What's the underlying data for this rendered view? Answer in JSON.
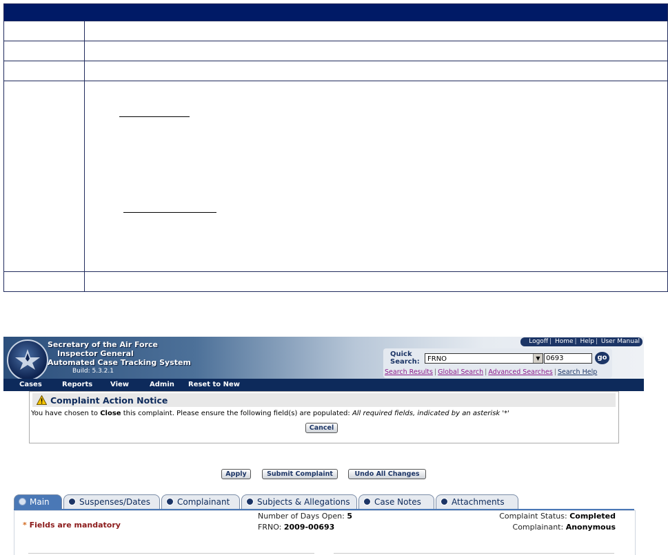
{
  "header": {
    "title_line1": "Secretary of the Air Force",
    "title_line2": "Inspector General",
    "title_line3": "Automated Case Tracking System",
    "build": "Build: 5.3.2.1"
  },
  "top_links": [
    "Logoff",
    "Home",
    "Help",
    "User Manual"
  ],
  "quick_search": {
    "label_line1": "Quick",
    "label_line2": "Search:",
    "field_selected": "FRNO",
    "value": "0693",
    "go_label": "go",
    "links": [
      "Search Results",
      "Global Search",
      "Advanced Searches",
      "Search Help"
    ]
  },
  "menu": [
    "Cases",
    "Reports",
    "View",
    "Admin",
    "Reset to New"
  ],
  "notice": {
    "title": "Complaint Action Notice",
    "text_prefix": "You have chosen to ",
    "text_action": "Close",
    "text_middle": " this complaint. Please ensure the following field(s) are populated: ",
    "text_fields": "All required fields, indicated by an asterisk '*'",
    "cancel_label": "Cancel"
  },
  "actions": {
    "apply": "Apply",
    "submit": "Submit Complaint",
    "undo": "Undo All Changes"
  },
  "tabs": [
    "Main",
    "Suspenses/Dates",
    "Complainant",
    "Subjects & Allegations",
    "Case Notes",
    "Attachments"
  ],
  "form": {
    "mandatory_asterisk": "*",
    "mandatory_text": " Fields are mandatory",
    "days_open_label": "Number of Days Open: ",
    "days_open_value": "5",
    "frno_label": "FRNO: ",
    "frno_value": "2009-00693",
    "status_label": "Complaint Status: ",
    "status_value": "Completed",
    "complainant_label": "Complainant: ",
    "complainant_value": "Anonymous"
  },
  "colors": {
    "table_header": "#001a66",
    "menubar": "#0d2a5b",
    "active_tab": "#4a78b6",
    "visited_link": "#8b1a8b",
    "mandatory_text": "#8b1a1a"
  }
}
